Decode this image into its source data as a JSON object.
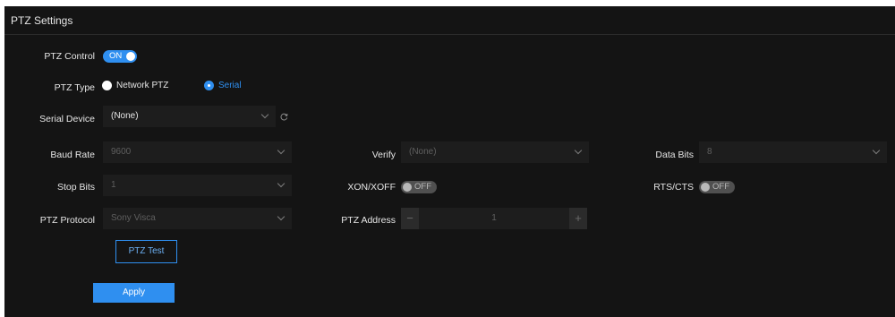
{
  "panel": {
    "title": "PTZ Settings"
  },
  "ptz_control": {
    "label": "PTZ Control",
    "state": "ON",
    "enabled": true
  },
  "ptz_type": {
    "label": "PTZ Type",
    "options": [
      {
        "label": "Network PTZ",
        "selected": false
      },
      {
        "label": "Serial",
        "selected": true
      }
    ]
  },
  "serial_device": {
    "label": "Serial Device",
    "value": "(None)",
    "refresh_icon": "refresh-icon"
  },
  "baud_rate": {
    "label": "Baud Rate",
    "value": "9600"
  },
  "verify": {
    "label": "Verify",
    "value": "(None)"
  },
  "data_bits": {
    "label": "Data Bits",
    "value": "8"
  },
  "stop_bits": {
    "label": "Stop Bits",
    "value": "1"
  },
  "xon_xoff": {
    "label": "XON/XOFF",
    "state": "OFF"
  },
  "rts_cts": {
    "label": "RTS/CTS",
    "state": "OFF"
  },
  "ptz_protocol": {
    "label": "PTZ Protocol",
    "value": "Sony Visca"
  },
  "ptz_address": {
    "label": "PTZ Address",
    "value": "1",
    "decrement": "−",
    "increment": "+"
  },
  "buttons": {
    "test": "PTZ Test",
    "apply": "Apply"
  },
  "colors": {
    "accent": "#2f8ff0",
    "background": "#141414",
    "field": "#1d1d1d",
    "text": "#e6e6e6",
    "disabled_text": "#5f5f5f"
  }
}
